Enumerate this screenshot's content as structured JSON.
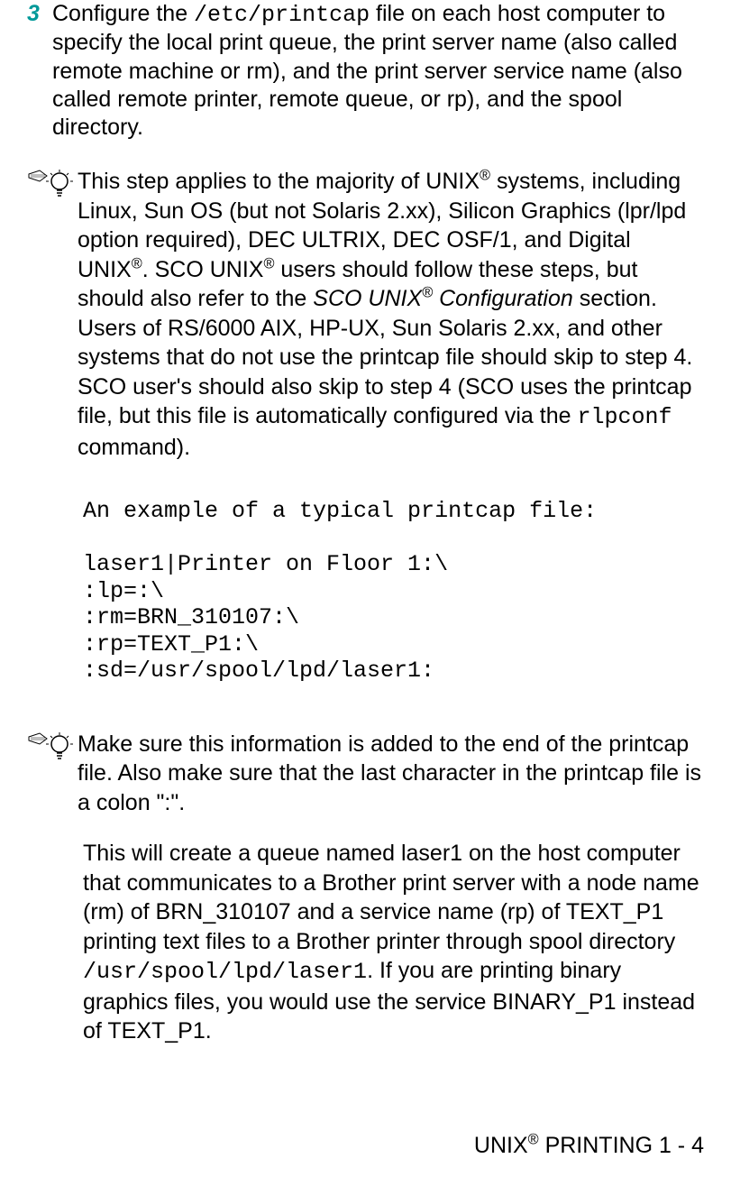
{
  "step": {
    "number": "3",
    "before_code": "Configure the ",
    "code": "/etc/printcap",
    "after_code": " file on each host computer to specify the local print queue, the print server name (also called remote machine or rm), and the print server service name (also called remote printer, remote queue, or rp), and the spool directory."
  },
  "note1": {
    "seg1": "This step applies to the majority of UNIX",
    "reg1": "®",
    "seg2": " systems, including Linux, Sun OS (but not Solaris 2.xx), Silicon Graphics (lpr/lpd option required), DEC ULTRIX, DEC OSF/1, and Digital UNIX",
    "reg2": "®",
    "seg3": ". SCO UNIX",
    "reg3": "®",
    "seg4": " users should follow these steps, but should also refer to the ",
    "italic_before": "SCO UNIX",
    "italic_reg": "®",
    "italic_after": " Configuration",
    "seg5": " section. Users of RS/6000 AIX, HP-UX, Sun Solaris 2.xx, and other systems that do not use the printcap file should skip to step 4. SCO user's should also skip to step 4 (SCO uses the printcap file, but this file is automatically configured via the ",
    "code": "rlpconf",
    "seg6": " command)."
  },
  "code_example": "An example of a typical printcap file:\n\nlaser1|Printer on Floor 1:\\\n:lp=:\\\n:rm=BRN_310107:\\\n:rp=TEXT_P1:\\\n:sd=/usr/spool/lpd/laser1:",
  "note2": {
    "text": "Make sure this information is added to the end of the printcap file. Also make sure that the last character in the printcap file is a colon \":\"."
  },
  "body": {
    "seg1": "This will create a queue named laser1 on the host computer that communicates to a Brother print server with a node name (rm) of BRN_310107 and a service name (rp) of TEXT_P1 printing text files to a Brother printer through spool directory ",
    "code": "/usr/spool/lpd/laser1",
    "seg2": ". If you are printing binary graphics files, you would use the service BINARY_P1 instead of TEXT_P1."
  },
  "footer": {
    "before_reg": "UNIX",
    "reg": "®",
    "after_reg": " PRINTING 1 - 4"
  }
}
